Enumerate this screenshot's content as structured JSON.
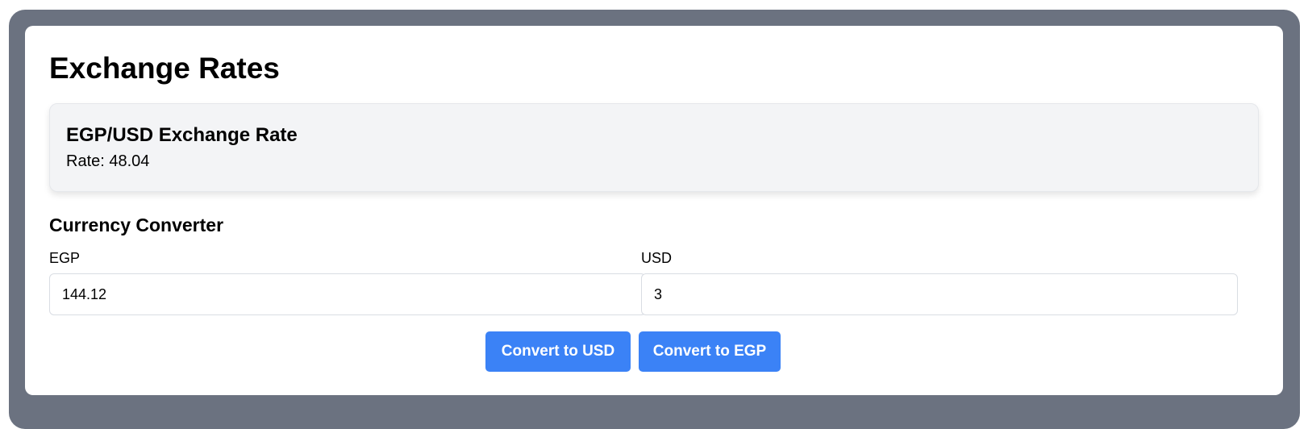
{
  "page": {
    "title": "Exchange Rates"
  },
  "rate_card": {
    "title": "EGP/USD Exchange Rate",
    "rate_label": "Rate:",
    "rate_value": "48.04"
  },
  "converter": {
    "title": "Currency Converter",
    "egp": {
      "label": "EGP",
      "value": "144.12"
    },
    "usd": {
      "label": "USD",
      "value": "3"
    },
    "convert_to_usd_label": "Convert to USD",
    "convert_to_egp_label": "Convert to EGP"
  },
  "colors": {
    "frame": "#6b7280",
    "card": "#ffffff",
    "rate_card_bg": "#f3f4f6",
    "button": "#3b82f6",
    "button_text": "#ffffff"
  }
}
